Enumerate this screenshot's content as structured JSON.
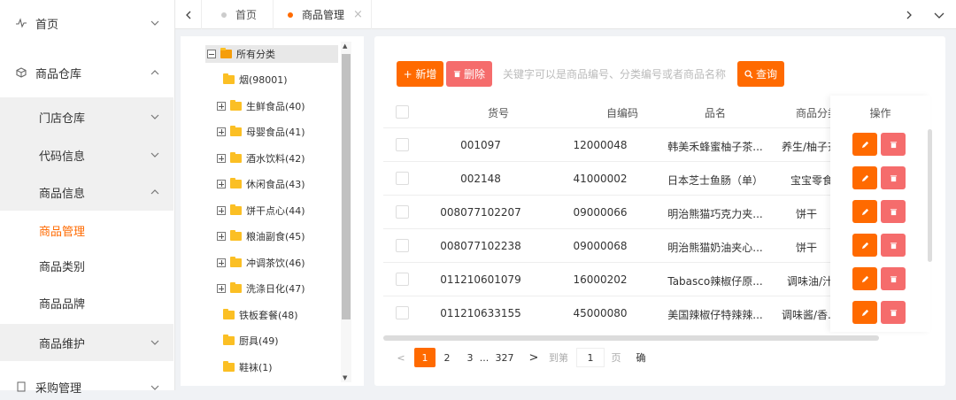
{
  "sidebar": {
    "items": [
      {
        "label": "首页"
      },
      {
        "label": "商品仓库"
      },
      {
        "label": "门店仓库"
      },
      {
        "label": "代码信息"
      },
      {
        "label": "商品信息"
      },
      {
        "label": "商品管理"
      },
      {
        "label": "商品类别"
      },
      {
        "label": "商品品牌"
      },
      {
        "label": "商品维护"
      },
      {
        "label": "采购管理"
      }
    ]
  },
  "tabs": [
    {
      "label": "首页",
      "dot_color": "#cccccc"
    },
    {
      "label": "商品管理",
      "dot_color": "#ff6a00",
      "close": "×"
    }
  ],
  "tree": {
    "root": "所有分类",
    "items": [
      {
        "label": "烟(98001)",
        "expandable": false
      },
      {
        "label": "生鲜食品(40)",
        "expandable": true
      },
      {
        "label": "母婴食品(41)",
        "expandable": true
      },
      {
        "label": "酒水饮料(42)",
        "expandable": true
      },
      {
        "label": "休闲食品(43)",
        "expandable": true
      },
      {
        "label": "饼干点心(44)",
        "expandable": true
      },
      {
        "label": "粮油副食(45)",
        "expandable": true
      },
      {
        "label": "冲调茶饮(46)",
        "expandable": true
      },
      {
        "label": "洗涤日化(47)",
        "expandable": true
      },
      {
        "label": "铁板套餐(48)",
        "expandable": false
      },
      {
        "label": "厨具(49)",
        "expandable": false
      },
      {
        "label": "鞋袜(1)",
        "expandable": false
      }
    ]
  },
  "toolbar": {
    "add_label": "+ 新增",
    "delete_label": "删除",
    "search_placeholder": "关键字可以是商品编号、分类编号或者商品名称",
    "query_label": "查询"
  },
  "table": {
    "headers": [
      "货号",
      "自编码",
      "品名",
      "商品分类",
      "操作"
    ],
    "rows": [
      {
        "code": "001097",
        "self_code": "12000048",
        "name": "韩美禾蜂蜜柚子茶...",
        "category": "养生/柚子茶"
      },
      {
        "code": "002148",
        "self_code": "41000002",
        "name": "日本芝士鱼肠（单）",
        "category": "宝宝零食"
      },
      {
        "code": "008077102207",
        "self_code": "09000066",
        "name": "明治熊猫巧克力夹...",
        "category": "饼干"
      },
      {
        "code": "008077102238",
        "self_code": "09000068",
        "name": "明治熊猫奶油夹心...",
        "category": "饼干"
      },
      {
        "code": "011210601079",
        "self_code": "16000202",
        "name": "Tabasco辣椒仔原...",
        "category": "调味油/汁"
      },
      {
        "code": "011210633155",
        "self_code": "45000080",
        "name": "美国辣椒仔特辣辣...",
        "category": "调味酱/香..."
      }
    ]
  },
  "pager": {
    "prev": "<",
    "pages": [
      "1",
      "2",
      "3",
      "...",
      "327"
    ],
    "next": ">",
    "goto_label": "到第",
    "goto_value": "1",
    "page_unit": "页",
    "confirm": "确"
  },
  "colors": {
    "accent": "#ff6a00",
    "danger": "#f56c6c"
  }
}
